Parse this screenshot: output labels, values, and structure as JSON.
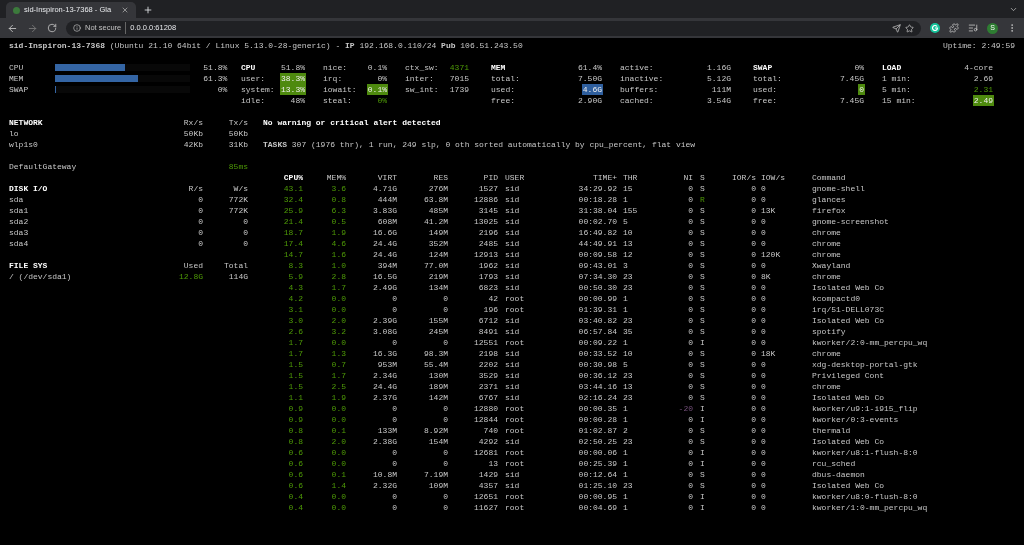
{
  "browser": {
    "tab_title": "sid-Inspiron-13-7368 - Gla",
    "security": "Not secure",
    "url": "0.0.0.0:61208",
    "profile_initial": "S"
  },
  "header": {
    "system": "**sid-Inspiron-13-7368** (Ubuntu 21.10 64bit / Linux 5.13.0-28-generic) - **IP** 192.168.0.110/24 **Pub** 106.51.243.50",
    "uptime": "Uptime: 2:49:59"
  },
  "quicklook": [
    {
      "label": "CPU",
      "level": 0.518,
      "value": "51.8%"
    },
    {
      "label": "MEM",
      "level": 0.613,
      "value": "61.3%"
    },
    {
      "label": "SWAP",
      "level": 0,
      "value": "0%"
    }
  ],
  "stat_blocks": [
    {
      "columns": [
        [
          {
            "label": "CPU",
            "value": "51.8%",
            "kind": "title"
          },
          {
            "label": "user:",
            "value": "38.3%",
            "kind": "okbg"
          },
          {
            "label": "system:",
            "value": "13.3%",
            "kind": "okbg"
          },
          {
            "label": "idle:",
            "value": "48%",
            "kind": "plain"
          }
        ],
        [
          {
            "label": "nice:",
            "value": "0.1%",
            "kind": "plain"
          },
          {
            "label": "irq:",
            "value": "0%",
            "kind": "plain"
          },
          {
            "label": "iowait:",
            "value": "0.1%",
            "kind": "okbg"
          },
          {
            "label": "steal:",
            "value": "0%",
            "kind": "ok"
          }
        ],
        [
          {
            "label": "ctx_sw:",
            "value": "4371",
            "kind": "ok"
          },
          {
            "label": "inter:",
            "value": "7015",
            "kind": "plain"
          },
          {
            "label": "sw_int:",
            "value": "1739",
            "kind": "plain"
          }
        ]
      ]
    },
    {
      "columns": [
        [
          {
            "label": "MEM",
            "value": "61.4%",
            "kind": "title"
          },
          {
            "label": "total:",
            "value": "7.50G",
            "kind": "plain"
          },
          {
            "label": "used:",
            "value": "4.6G",
            "kind": "infobg"
          },
          {
            "label": "free:",
            "value": "2.90G",
            "kind": "plain"
          }
        ],
        [
          {
            "label": "active:",
            "value": "1.16G",
            "kind": "plain"
          },
          {
            "label": "inactive:",
            "value": "5.12G",
            "kind": "plain"
          },
          {
            "label": "buffers:",
            "value": "111M",
            "kind": "plain"
          },
          {
            "label": "cached:",
            "value": "3.54G",
            "kind": "plain"
          }
        ]
      ]
    },
    {
      "columns": [
        [
          {
            "label": "SWAP",
            "value": "0%",
            "kind": "title"
          },
          {
            "label": "total:",
            "value": "7.45G",
            "kind": "plain"
          },
          {
            "label": "used:",
            "value": "0",
            "kind": "okbg"
          },
          {
            "label": "free:",
            "value": "7.45G",
            "kind": "plain"
          }
        ],
        [
          {
            "label": "LOAD",
            "value": "4-core",
            "kind": "title"
          },
          {
            "label": "1 min:",
            "value": "2.69",
            "kind": "plain"
          },
          {
            "label": "5 min:",
            "value": "2.31",
            "kind": "ok"
          },
          {
            "label": "15 min:",
            "value": "2.49",
            "kind": "okbg"
          }
        ]
      ]
    }
  ],
  "network": {
    "columns": [
      "NETWORK",
      "Rx/s",
      "Tx/s"
    ],
    "rows": [
      [
        "lo",
        "50Kb",
        "50Kb"
      ],
      [
        "wlp1s0",
        "42Kb",
        "31Kb"
      ]
    ]
  },
  "gateway": {
    "label": "DefaultGateway",
    "value": "85ms"
  },
  "disk_io": {
    "columns": [
      "DISK I/O",
      "R/s",
      "W/s"
    ],
    "rows": [
      [
        "sda",
        "0",
        "772K"
      ],
      [
        "sda1",
        "0",
        "772K"
      ],
      [
        "sda2",
        "0",
        "0"
      ],
      [
        "sda3",
        "0",
        "0"
      ],
      [
        "sda4",
        "0",
        "0"
      ]
    ]
  },
  "file_sys": {
    "columns": [
      "FILE SYS",
      "Used",
      "Total"
    ],
    "rows": [
      [
        "/ (/dev/sda1)",
        "12.8G",
        "114G"
      ]
    ]
  },
  "alert": "No warning or critical alert detected",
  "tasks": "**TASKS** 307 (1976 thr), 1 run, 249 slp, 0 oth sorted automatically by cpu_percent, flat view",
  "process_table": {
    "columns": [
      {
        "label": "CPU%",
        "sorted": true
      },
      {
        "label": "MEM%",
        "sorted": false
      },
      {
        "label": "VIRT",
        "sorted": false
      },
      {
        "label": "RES",
        "sorted": false
      },
      {
        "label": "PID",
        "sorted": false
      },
      {
        "label": "USER",
        "sorted": false
      },
      {
        "label": "TIME+",
        "sorted": false
      },
      {
        "label": "THR",
        "sorted": false
      },
      {
        "label": "NI",
        "sorted": false
      },
      {
        "label": "S",
        "sorted": false
      },
      {
        "label": "IOR/s",
        "sorted": false
      },
      {
        "label": "IOW/s",
        "sorted": false
      },
      {
        "label": "Command",
        "sorted": false
      }
    ],
    "rows": [
      {
        "cells": [
          "43.1",
          "3.6",
          "4.71G",
          "276M",
          "1527",
          "sid",
          "34:29.92",
          "15",
          "0",
          "S",
          "0",
          "0",
          "gnome-shell"
        ],
        "niced": false,
        "running": false
      },
      {
        "cells": [
          "32.4",
          "0.8",
          "444M",
          "63.8M",
          "12886",
          "sid",
          "00:18.28",
          "1",
          "0",
          "R",
          "0",
          "0",
          "glances"
        ],
        "niced": false,
        "running": true
      },
      {
        "cells": [
          "25.9",
          "6.3",
          "3.83G",
          "485M",
          "3145",
          "sid",
          "31:38.04",
          "155",
          "0",
          "S",
          "0",
          "13K",
          "firefox"
        ],
        "niced": false,
        "running": false
      },
      {
        "cells": [
          "21.4",
          "0.5",
          "608M",
          "41.2M",
          "13025",
          "sid",
          "00:02.70",
          "5",
          "0",
          "S",
          "0",
          "0",
          "gnome-screenshot"
        ],
        "niced": false,
        "running": false
      },
      {
        "cells": [
          "18.7",
          "1.9",
          "16.6G",
          "149M",
          "2196",
          "sid",
          "16:49.82",
          "10",
          "0",
          "S",
          "0",
          "0",
          "chrome"
        ],
        "niced": false,
        "running": false
      },
      {
        "cells": [
          "17.4",
          "4.6",
          "24.4G",
          "352M",
          "2485",
          "sid",
          "44:49.91",
          "13",
          "0",
          "S",
          "0",
          "0",
          "chrome"
        ],
        "niced": false,
        "running": false
      },
      {
        "cells": [
          "14.7",
          "1.6",
          "24.4G",
          "124M",
          "12913",
          "sid",
          "00:09.58",
          "12",
          "0",
          "S",
          "0",
          "120K",
          "chrome"
        ],
        "niced": false,
        "running": false
      },
      {
        "cells": [
          "8.3",
          "1.0",
          "394M",
          "77.0M",
          "1962",
          "sid",
          "09:43.01",
          "3",
          "0",
          "S",
          "0",
          "0",
          "Xwayland"
        ],
        "niced": false,
        "running": false
      },
      {
        "cells": [
          "5.9",
          "2.8",
          "16.5G",
          "219M",
          "1793",
          "sid",
          "07:34.30",
          "23",
          "0",
          "S",
          "0",
          "8K",
          "chrome"
        ],
        "niced": false,
        "running": false
      },
      {
        "cells": [
          "4.3",
          "1.7",
          "2.49G",
          "134M",
          "6823",
          "sid",
          "00:50.30",
          "23",
          "0",
          "S",
          "0",
          "0",
          "Isolated Web Co"
        ],
        "niced": false,
        "running": false
      },
      {
        "cells": [
          "4.2",
          "0.0",
          "0",
          "0",
          "42",
          "root",
          "00:00.99",
          "1",
          "0",
          "S",
          "0",
          "0",
          "kcompactd0"
        ],
        "niced": false,
        "running": false
      },
      {
        "cells": [
          "3.1",
          "0.0",
          "0",
          "0",
          "196",
          "root",
          "01:39.31",
          "1",
          "0",
          "S",
          "0",
          "0",
          "irq/51-DELL073C"
        ],
        "niced": false,
        "running": false
      },
      {
        "cells": [
          "3.0",
          "2.0",
          "2.39G",
          "155M",
          "6712",
          "sid",
          "03:40.82",
          "23",
          "0",
          "S",
          "0",
          "0",
          "Isolated Web Co"
        ],
        "niced": false,
        "running": false
      },
      {
        "cells": [
          "2.6",
          "3.2",
          "3.08G",
          "245M",
          "8491",
          "sid",
          "06:57.84",
          "35",
          "0",
          "S",
          "0",
          "0",
          "spotify"
        ],
        "niced": false,
        "running": false
      },
      {
        "cells": [
          "1.7",
          "0.0",
          "0",
          "0",
          "12551",
          "root",
          "00:09.22",
          "1",
          "0",
          "I",
          "0",
          "0",
          "kworker/2:0-mm_percpu_wq"
        ],
        "niced": false,
        "running": false
      },
      {
        "cells": [
          "1.7",
          "1.3",
          "16.3G",
          "98.3M",
          "2198",
          "sid",
          "00:33.52",
          "10",
          "0",
          "S",
          "0",
          "18K",
          "chrome"
        ],
        "niced": false,
        "running": false
      },
      {
        "cells": [
          "1.5",
          "0.7",
          "953M",
          "55.4M",
          "2202",
          "sid",
          "00:30.98",
          "5",
          "0",
          "S",
          "0",
          "0",
          "xdg-desktop-portal-gtk"
        ],
        "niced": false,
        "running": false
      },
      {
        "cells": [
          "1.5",
          "1.7",
          "2.34G",
          "130M",
          "3529",
          "sid",
          "00:36.12",
          "23",
          "0",
          "S",
          "0",
          "0",
          "Privileged Cont"
        ],
        "niced": false,
        "running": false
      },
      {
        "cells": [
          "1.5",
          "2.5",
          "24.4G",
          "189M",
          "2371",
          "sid",
          "03:44.16",
          "13",
          "0",
          "S",
          "0",
          "0",
          "chrome"
        ],
        "niced": false,
        "running": false
      },
      {
        "cells": [
          "1.1",
          "1.9",
          "2.37G",
          "142M",
          "6767",
          "sid",
          "02:16.24",
          "23",
          "0",
          "S",
          "0",
          "0",
          "Isolated Web Co"
        ],
        "niced": false,
        "running": false
      },
      {
        "cells": [
          "0.9",
          "0.0",
          "0",
          "0",
          "12880",
          "root",
          "00:00.35",
          "1",
          "-20",
          "I",
          "0",
          "0",
          "kworker/u9:1-i915_flip"
        ],
        "niced": true,
        "running": false
      },
      {
        "cells": [
          "0.9",
          "0.0",
          "0",
          "0",
          "12844",
          "root",
          "00:00.28",
          "1",
          "0",
          "I",
          "0",
          "0",
          "kworker/0:3-events"
        ],
        "niced": false,
        "running": false
      },
      {
        "cells": [
          "0.8",
          "0.1",
          "133M",
          "8.92M",
          "740",
          "root",
          "01:02.87",
          "2",
          "0",
          "S",
          "0",
          "0",
          "thermald"
        ],
        "niced": false,
        "running": false
      },
      {
        "cells": [
          "0.8",
          "2.0",
          "2.38G",
          "154M",
          "4292",
          "sid",
          "02:50.25",
          "23",
          "0",
          "S",
          "0",
          "0",
          "Isolated Web Co"
        ],
        "niced": false,
        "running": false
      },
      {
        "cells": [
          "0.6",
          "0.0",
          "0",
          "0",
          "12681",
          "root",
          "00:00.06",
          "1",
          "0",
          "I",
          "0",
          "0",
          "kworker/u8:1-flush-8:0"
        ],
        "niced": false,
        "running": false
      },
      {
        "cells": [
          "0.6",
          "0.0",
          "0",
          "0",
          "13",
          "root",
          "00:25.39",
          "1",
          "0",
          "I",
          "0",
          "0",
          "rcu_sched"
        ],
        "niced": false,
        "running": false
      },
      {
        "cells": [
          "0.6",
          "0.1",
          "10.8M",
          "7.19M",
          "1429",
          "sid",
          "00:12.64",
          "1",
          "0",
          "S",
          "0",
          "0",
          "dbus-daemon"
        ],
        "niced": false,
        "running": false
      },
      {
        "cells": [
          "0.6",
          "1.4",
          "2.32G",
          "109M",
          "4357",
          "sid",
          "01:25.10",
          "23",
          "0",
          "S",
          "0",
          "0",
          "Isolated Web Co"
        ],
        "niced": false,
        "running": false
      },
      {
        "cells": [
          "0.4",
          "0.0",
          "0",
          "0",
          "12651",
          "root",
          "00:00.95",
          "1",
          "0",
          "I",
          "0",
          "0",
          "kworker/u8:0-flush-8:0"
        ],
        "niced": false,
        "running": false
      },
      {
        "cells": [
          "0.4",
          "0.0",
          "0",
          "0",
          "11627",
          "root",
          "00:04.69",
          "1",
          "0",
          "I",
          "0",
          "0",
          "kworker/1:0-mm_percpu_wq"
        ],
        "niced": false,
        "running": false
      }
    ]
  }
}
